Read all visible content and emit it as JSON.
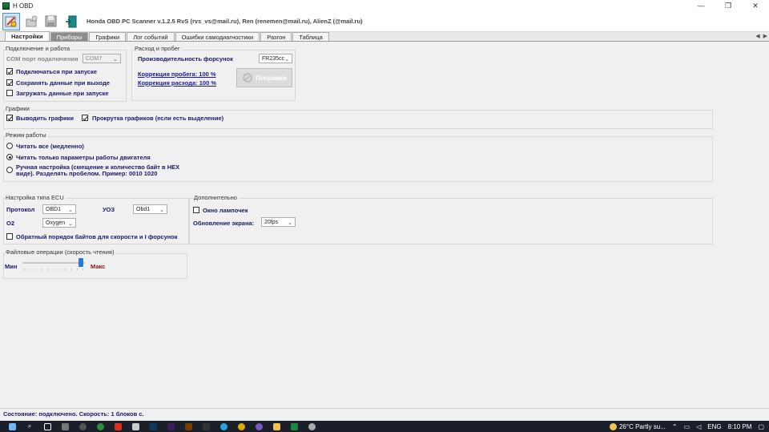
{
  "window": {
    "title": "H OBD",
    "controls": [
      "—",
      "❐",
      "✕"
    ]
  },
  "toolbar": {
    "app_title": "Honda OBD PC Scanner v.1.2.5  RvS (rvs_vs@mail.ru), Ren (renemen@mail.ru), AlienZ (@mail.ru)"
  },
  "tabs": [
    {
      "label": "Настройки"
    },
    {
      "label": "Приборы"
    },
    {
      "label": "Графики"
    },
    {
      "label": "Лог событий"
    },
    {
      "label": "Ошибки самодиагностики"
    },
    {
      "label": "Разгон"
    },
    {
      "label": "Таблица"
    }
  ],
  "tab_scroll": {
    "left": "◀",
    "right": "▶"
  },
  "connection": {
    "title": "Подключение и работа",
    "com_label": "COM порт подключения",
    "com_value": "COM7",
    "connect_on_start": "Подключаться при запуске",
    "save_on_exit": "Сохранять данные при выходе",
    "load_on_start": "Загружать данные при запуске"
  },
  "consumption": {
    "title": "Расход и пробег",
    "injector_label": "Производительность форсунок",
    "injector_value": "FR235cc",
    "mileage_correction": "Коррекция пробега: 100 %",
    "fuel_correction": "Коррекция расхода: 100 %",
    "fix_button": "Поправки"
  },
  "graphs": {
    "title": "Графики",
    "show_graphs": "Выводить графики",
    "scroll_graphs": "Прокрутка графиков (если есть выделение)"
  },
  "mode": {
    "title": "Режим работы",
    "read_all": "Читать все (медленно)",
    "read_engine": "Читать только параметры работы двигателя",
    "manual_line1": "Ручная настройка (смещение и количество байт в HEX",
    "manual_line2": "виде). Разделять пробелом. Пример: 0010 1020"
  },
  "ecu": {
    "title": "Настройка типа  ECU",
    "protocol_label": "Протокол",
    "protocol_value": "OBD1",
    "uoz_label": "УОЗ",
    "uoz_value": "Obd1",
    "o2_label": "O2",
    "o2_value": "Oxygen",
    "reverse_bytes": "Обратный порядок байтов для скорости и I форсунок"
  },
  "extra": {
    "title": "Дополнительно",
    "lamp_window": "Окно лампочек",
    "refresh_label": "Обновление экрана:",
    "refresh_value": "20fps"
  },
  "file_ops": {
    "title": "Файловые операции (скорость чтения)",
    "min_label": "Мин",
    "max_label": "Макс",
    "speed_fraction": 0.97
  },
  "status": {
    "text": "Состояние: подключено. Скорость: 1 блоков с."
  },
  "taskbar": {
    "weather": "26°C  Partly su...",
    "lang": "ENG",
    "time": "8:10 PM"
  },
  "colors": {
    "accent": "#2a7bd6",
    "label_blue": "#1a1a6a",
    "link_blue": "#1a1aa0",
    "max_red": "#8b1a1a"
  }
}
